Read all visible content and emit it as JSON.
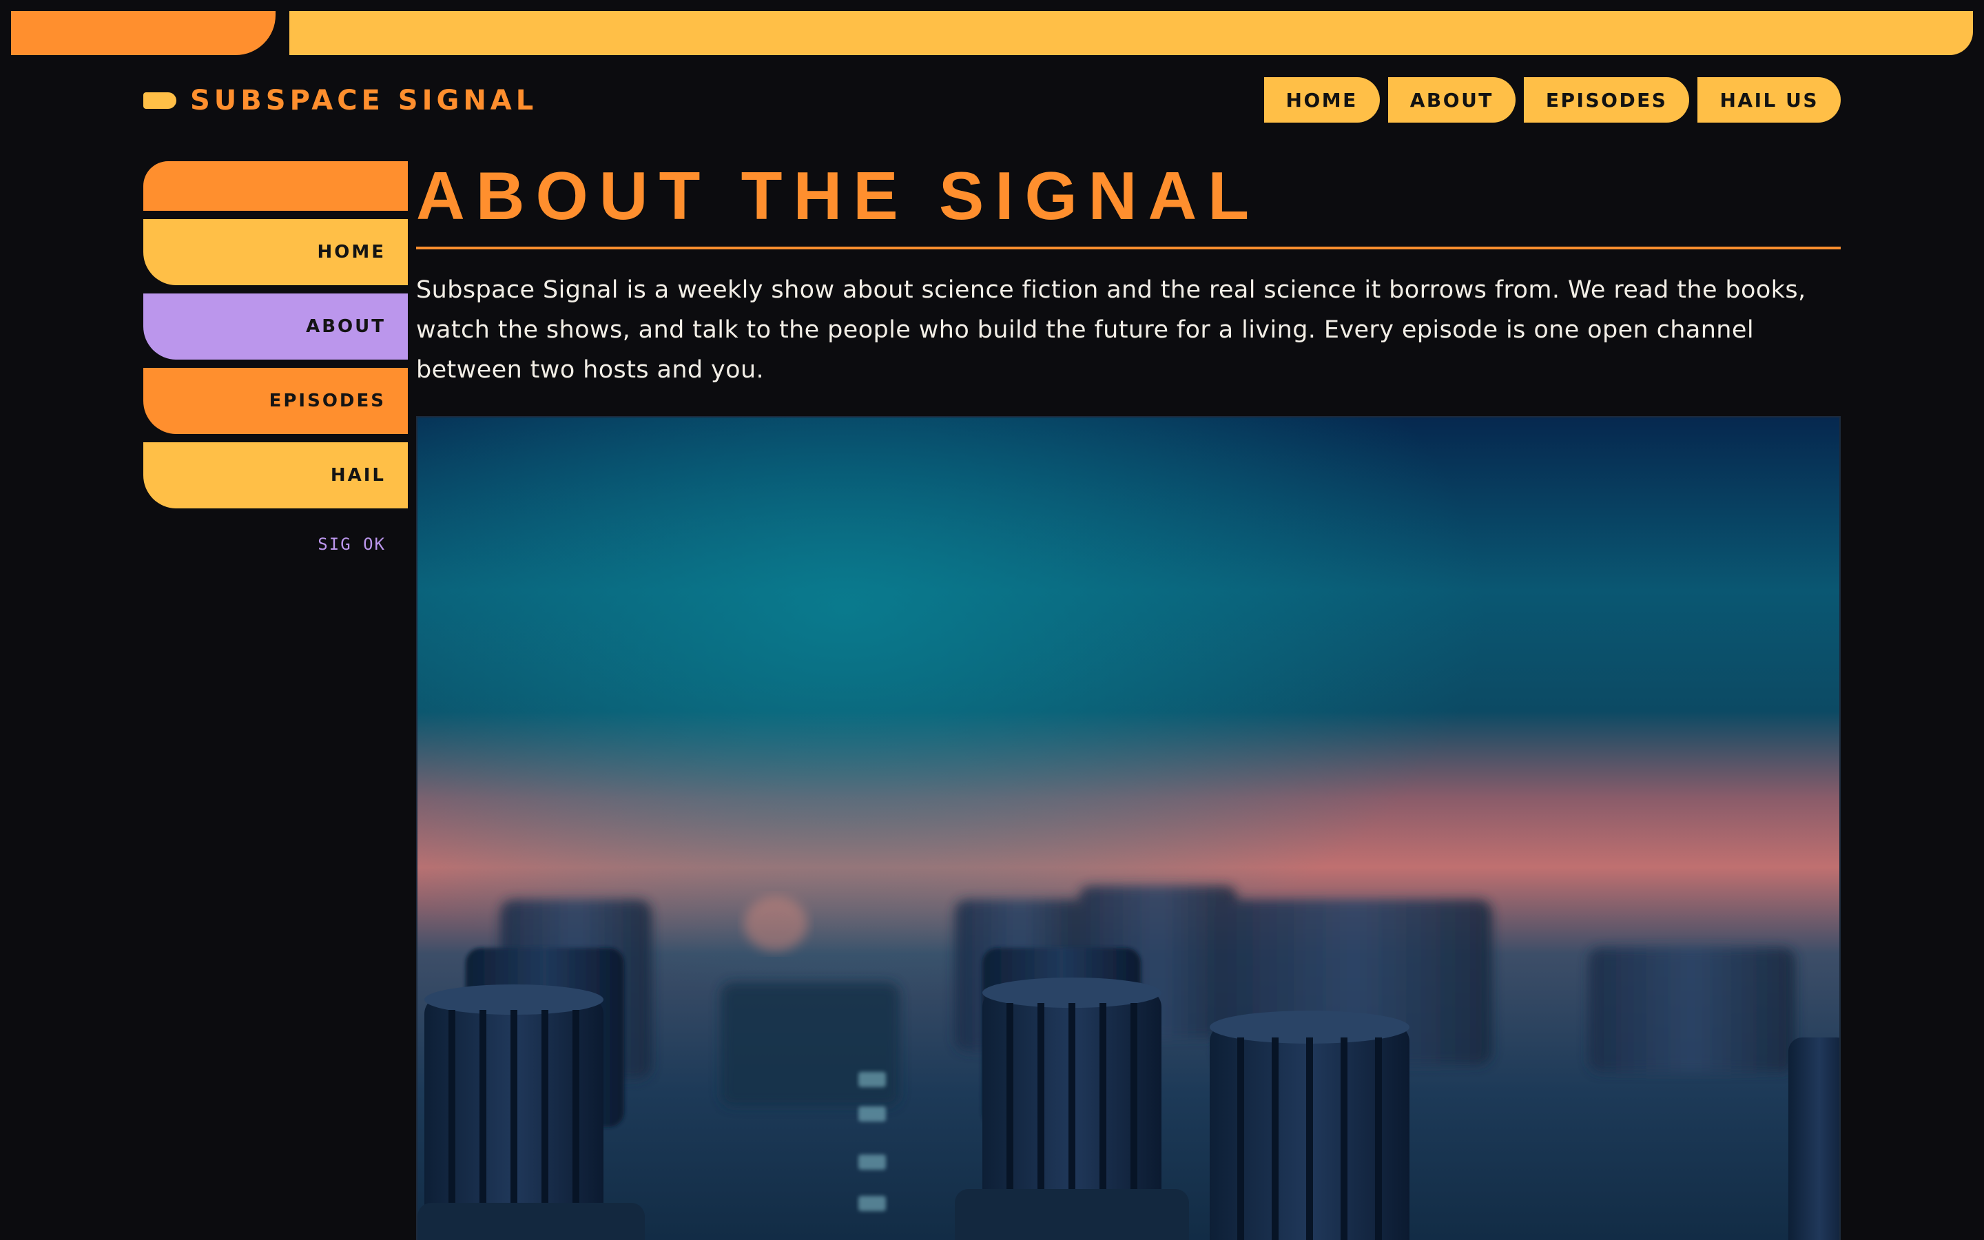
{
  "brand": {
    "name": "SUBSPACE SIGNAL"
  },
  "top_nav": {
    "items": [
      {
        "label": "HOME"
      },
      {
        "label": "ABOUT"
      },
      {
        "label": "EPISODES"
      },
      {
        "label": "HAIL US"
      }
    ]
  },
  "sidebar": {
    "items": [
      {
        "label": "HOME"
      },
      {
        "label": "ABOUT"
      },
      {
        "label": "EPISODES"
      },
      {
        "label": "HAIL"
      }
    ],
    "status": "SIG OK"
  },
  "main": {
    "title": "ABOUT THE SIGNAL",
    "intro": "Subspace Signal is a weekly show about science fiction and the real science it borrows from. We read the books, watch the shows, and talk to the people who build the future for a living. Every episode is one open channel between two hosts and you."
  },
  "hero": {
    "image_icon": "mixing-console-photo"
  },
  "colors": {
    "background": "#0c0c0f",
    "orange": "#ff8f2e",
    "yellow": "#ffbf47",
    "violet": "#bb96ec",
    "text": "#f2eee6"
  }
}
